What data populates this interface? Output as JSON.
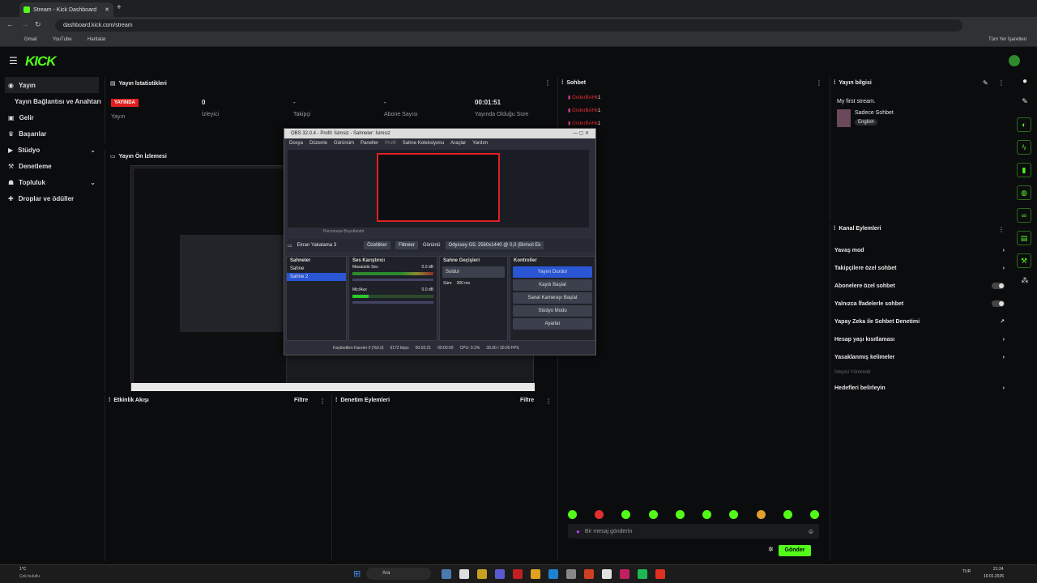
{
  "browser": {
    "tab_title": "Stream - Kick Dashboard",
    "url": "dashboard.kick.com/stream",
    "bookmarks": [
      "Gmail",
      "YouTube",
      "Haritalar"
    ],
    "all_bookmarks": "Tüm Yer İşaretleri"
  },
  "brand": {
    "logo": "KICK",
    "accent": "#53fc18"
  },
  "sidebar": {
    "items": [
      {
        "label": "Yayın"
      },
      {
        "label": "Yayın Bağlantısı ve Anahtarı"
      },
      {
        "label": "Gelir"
      },
      {
        "label": "Başarılar"
      },
      {
        "label": "Stüdyo"
      },
      {
        "label": "Denetleme"
      },
      {
        "label": "Topluluk"
      },
      {
        "label": "Droplar ve ödüller"
      }
    ]
  },
  "stats": {
    "title": "Yayın İstatistikleri",
    "live_badge": "YAYINDA",
    "live_label": "Yayın",
    "viewers_value": "0",
    "viewers_label": "İzleyici",
    "followers_value": "-",
    "followers_label": "Takipçi",
    "subs_value": "-",
    "subs_label": "Abone Sayısı",
    "uptime_value": "00:01:51",
    "uptime_label": "Yayında Olduğu Süre"
  },
  "preview": {
    "title": "Yayın Ön İzlemesi"
  },
  "activity": {
    "title": "Etkinlik Akışı",
    "filter": "Filtre"
  },
  "modactions": {
    "title": "Denetim Eylemleri",
    "filter": "Filtre"
  },
  "chat": {
    "title": "Sohbet",
    "messages": [
      {
        "user": "OnderBAHk",
        "text": "1"
      },
      {
        "user": "OnderBAHk",
        "text": "1"
      },
      {
        "user": "OnderBAHk",
        "text": "1"
      }
    ],
    "placeholder": "Bir mesaj gönderin",
    "send": "Gönder"
  },
  "info": {
    "title": "Yayın bilgisi",
    "stream_title": "My first stream.",
    "category": "Sadece Sohbet",
    "language": "English"
  },
  "channel_actions": {
    "title": "Kanal Eylemleri",
    "items": [
      "Yavaş mod",
      "Takipçilere özel sohbet",
      "Abonelere özel sohbet",
      "Yalnızca İfadelerle sohbet",
      "Yapay Zeka ile Sohbet Denetimi",
      "Hesap yaşı kısıtlaması",
      "Yasaklanmış kelimeler"
    ],
    "section": "İzleyici Yönlendir",
    "target": "Hedefleri belirleyin"
  },
  "obs": {
    "title": "OBS 32.0.4 - Profil: İsimsiz - Sahneler: İsimsiz",
    "menu": [
      "Dosya",
      "Düzenle",
      "Görünüm",
      "Paneller",
      "Profil",
      "Sahne Koleksiyonu",
      "Araçlar",
      "Yardım"
    ],
    "zoom": "Pencereye Boyutlandır",
    "source": "Ekran Yakalama 3",
    "properties": "Özellikler",
    "filters": "Filtreler",
    "display_label": "Görüntü",
    "display_value": "Odyssey G5: 2560x1440 @ 0,0 (Birincil Ek",
    "scenes_title": "Sahneler",
    "scenes": [
      "Sahne",
      "Sahne 2"
    ],
    "mixer_title": "Ses Karıştırıcı",
    "desktop_audio": "Masaüstü Ses",
    "desktop_db": "0.0 dB",
    "mic": "Mic/Aux",
    "mic_db": "0.0 dB",
    "transitions_title": "Sahne Geçişleri",
    "transition": "Soldur",
    "duration_label": "Süre",
    "duration": "300 ms",
    "controls_title": "Kontroller",
    "controls": [
      "Yayını Durdur",
      "Kaydı Başlat",
      "Sanal Kamerayı Başlat",
      "Stüdyo Modu",
      "Ayarlar"
    ],
    "status_dropped": "Kaybedilen Kareler 0 (%0.0)",
    "status_kbps": "6172 kbps",
    "status_time": "00:02:21",
    "status_rec": "00:00:00",
    "status_cpu": "CPU: 0.2%",
    "status_fps": "30.00 / 30.00 FPS"
  },
  "taskbar": {
    "weather": "1°C",
    "weather_desc": "Çok bulutlu",
    "search": "Ara",
    "lang": "TUR",
    "time": "21:24",
    "date": "19.01.2026"
  }
}
